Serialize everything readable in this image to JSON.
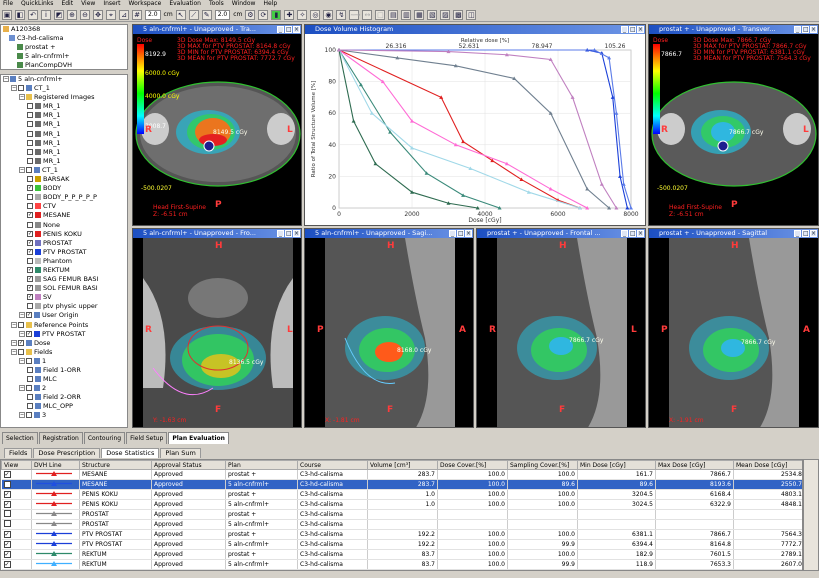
{
  "menu": [
    "File",
    "QuickLinks",
    "Edit",
    "View",
    "Insert",
    "Workspace",
    "Evaluation",
    "Tools",
    "Window",
    "Help"
  ],
  "toolbar": {
    "thickness1": "2.0",
    "unit1": "cm",
    "thickness2": "2.0",
    "unit2": "cm"
  },
  "patient_tree": [
    "A120368",
    "C3-hd-calisma",
    "prostat +",
    "5 aln-cnfrml+",
    "PlanCompDVH"
  ],
  "left_tree": [
    {
      "t": "5 aln-cnfrml+",
      "d": 0
    },
    {
      "t": "CT_1",
      "d": 1
    },
    {
      "t": "Registered Images",
      "d": 2
    },
    {
      "t": "MR_1",
      "d": 3
    },
    {
      "t": "MR_1",
      "d": 3
    },
    {
      "t": "MR_1",
      "d": 3
    },
    {
      "t": "MR_1",
      "d": 3
    },
    {
      "t": "MR_1",
      "d": 3
    },
    {
      "t": "MR_1",
      "d": 3
    },
    {
      "t": "MR_1",
      "d": 3
    },
    {
      "t": "CT_1",
      "d": 2
    },
    {
      "t": "BARSAK",
      "d": 3
    },
    {
      "t": "BODY",
      "d": 3
    },
    {
      "t": "BODY_P_P_P_P_P",
      "d": 3
    },
    {
      "t": "CTV",
      "d": 3
    },
    {
      "t": "MESANE",
      "d": 3
    },
    {
      "t": "None",
      "d": 3
    },
    {
      "t": "PENIS KOKU",
      "d": 3
    },
    {
      "t": "PROSTAT",
      "d": 3
    },
    {
      "t": "PTV PROSTAT",
      "d": 3
    },
    {
      "t": "Phantom",
      "d": 3
    },
    {
      "t": "REKTUM",
      "d": 3
    },
    {
      "t": "SAG FEMUR BASI",
      "d": 3
    },
    {
      "t": "SOL FEMUR BASI",
      "d": 3
    },
    {
      "t": "SV",
      "d": 3
    },
    {
      "t": "ptv physic upper",
      "d": 3
    },
    {
      "t": "User Origin",
      "d": 2
    },
    {
      "t": "Reference Points",
      "d": 1
    },
    {
      "t": "PTV PROSTAT",
      "d": 2
    },
    {
      "t": "Dose",
      "d": 1
    },
    {
      "t": "Fields",
      "d": 1
    },
    {
      "t": "1",
      "d": 2
    },
    {
      "t": "Field 1-ORR",
      "d": 3
    },
    {
      "t": "MLC",
      "d": 3
    },
    {
      "t": "2",
      "d": 2
    },
    {
      "t": "Field 2-ORR",
      "d": 3
    },
    {
      "t": "MLC_OPP",
      "d": 3
    },
    {
      "t": "3",
      "d": 2
    }
  ],
  "panels": {
    "p1": "5 aln-cnfrml+ - Unapproved - Tra...",
    "p2": "Dose Volume Histogram",
    "p3": "prostat + - Unapproved - Transver...",
    "p4": "5 aln-cnfrml+ - Unapproved - Fro...",
    "p5": "5 aln-cnfrml+ - Unapproved - Sagi...",
    "p6": "prostat + - Unapproved - Frontal ...",
    "p7": "prostat + - Unapproved - Sagittal"
  },
  "img1": {
    "dose": "Dose",
    "v1": "8192.9",
    "v2": "6000.0 cGy",
    "v3": "4000.0 cGy",
    "v4": "3008.7",
    "l1": "3D Dose Max: 8149.5 cGy",
    "l2": "3D MAX for PTV PROSTAT: 8164.8 cGy",
    "l3": "3D MIN for PTV PROSTAT: 6394.4 cGy",
    "l4": "3D MEAN for PTV PROSTAT: 7772.7 cGy",
    "center": "8149.5 cGy",
    "bottom": "-500.0207",
    "pos": "Head First-Supine",
    "z": "Z: -6.51 cm",
    "R": "R",
    "L": "L",
    "P": "P"
  },
  "img3": {
    "dose": "Dose",
    "v1": "7866.7",
    "l1": "3D Dose Max: 7866.7 cGy",
    "l2": "3D MAX for PTV PROSTAT: 7866.7 cGy",
    "l3": "3D MIN for PTV PROSTAT: 6381.1 cGy",
    "l4": "3D MEAN for PTV PROSTAT: 7564.3 cGy",
    "center": "7866.7 cGy",
    "bottom": "-500.0207",
    "pos": "Head First-Supine",
    "z": "Z: -6.51 cm",
    "R": "R",
    "L": "L",
    "P": "P"
  },
  "img4": {
    "R": "R",
    "L": "L",
    "F": "F",
    "H": "H",
    "center": "8136.5 cGy",
    "y": "Y: -1.63 cm"
  },
  "img5": {
    "P": "P",
    "A": "A",
    "H": "H",
    "F": "F",
    "center": "8168.0 cGy",
    "x": "X: -1.81 cm"
  },
  "img6": {
    "R": "R",
    "L": "L",
    "H": "H",
    "F": "F",
    "center": "7866.7 cGy"
  },
  "img7": {
    "P": "P",
    "A": "A",
    "H": "H",
    "F": "F",
    "center": "7866.7 cGy",
    "x": "X: -1.91 cm"
  },
  "chart_data": {
    "type": "line",
    "title": "",
    "xlabel": "Dose [cGy]",
    "ylabel": "Ratio of Total Structure Volume [%]",
    "x2label": "Relative dose [%]",
    "x2ticks": [
      "26.316",
      "52.631",
      "78.947",
      "105.26"
    ],
    "xlim": [
      0,
      8000
    ],
    "ylim": [
      0,
      100
    ],
    "xticks": [
      0,
      2000,
      4000,
      6000,
      8000
    ],
    "yticks": [
      0,
      20,
      40,
      60,
      80,
      100
    ],
    "series": [
      {
        "color": "#1a3fd8",
        "x": [
          0,
          6800,
          7200,
          7500,
          7700,
          7900
        ],
        "y": [
          100,
          100,
          98,
          70,
          20,
          0
        ]
      },
      {
        "color": "#5b7be8",
        "x": [
          0,
          7000,
          7400,
          7600,
          7800,
          8000
        ],
        "y": [
          100,
          100,
          95,
          60,
          15,
          0
        ]
      },
      {
        "color": "#e02020",
        "x": [
          0,
          2800,
          3400,
          4200,
          5000,
          6000,
          6600
        ],
        "y": [
          100,
          70,
          42,
          30,
          18,
          5,
          0
        ]
      },
      {
        "color": "#ff6ad5",
        "x": [
          0,
          1200,
          2000,
          3200,
          4600,
          5800,
          6800
        ],
        "y": [
          100,
          80,
          55,
          40,
          28,
          12,
          0
        ]
      },
      {
        "color": "#3a8a7a",
        "x": [
          0,
          600,
          1400,
          2400,
          3400,
          4400
        ],
        "y": [
          100,
          78,
          48,
          22,
          8,
          0
        ]
      },
      {
        "color": "#708090",
        "x": [
          0,
          1600,
          3200,
          4800,
          5800,
          6800,
          7400
        ],
        "y": [
          100,
          95,
          90,
          82,
          60,
          12,
          0
        ]
      },
      {
        "color": "#a0d8e8",
        "x": [
          0,
          900,
          2000,
          3600,
          5200,
          6600
        ],
        "y": [
          100,
          60,
          38,
          25,
          10,
          0
        ]
      },
      {
        "color": "#2e6b50",
        "x": [
          0,
          400,
          1000,
          2000,
          3000,
          3800
        ],
        "y": [
          100,
          55,
          28,
          10,
          3,
          0
        ]
      },
      {
        "color": "#c080c0",
        "x": [
          0,
          3000,
          4600,
          5800,
          6400,
          7200,
          7600
        ],
        "y": [
          100,
          99,
          97,
          94,
          70,
          15,
          0
        ]
      }
    ]
  },
  "tabs": [
    "Selection",
    "Registration",
    "Contouring",
    "Field Setup",
    "Plan Evaluation"
  ],
  "subtabs": [
    "Fields",
    "Dose Prescription",
    "Dose Statistics",
    "Plan Sum"
  ],
  "table": {
    "headers": [
      "View",
      "DVH Line",
      "Structure",
      "Approval Status",
      "Plan",
      "Course",
      "Volume [cm³]",
      "Dose Cover.[%]",
      "Sampling Cover.[%]",
      "Min Dose [cGy]",
      "Max Dose [cGy]",
      "Mean Dose [cGy]"
    ],
    "rows": [
      {
        "v": true,
        "c": "#e02020",
        "s": "MESANE",
        "a": "Approved",
        "p": "prostat +",
        "co": "C3-hd-calisma",
        "vol": "283.7",
        "dc": "100.0",
        "sc": "100.0",
        "mn": "161.7",
        "mx": "7866.7",
        "me": "2534.8",
        "sel": false
      },
      {
        "v": true,
        "c": "#2050e0",
        "s": "MESANE",
        "a": "Approved",
        "p": "5 aln-cnfrml+",
        "co": "C3-hd-calisma",
        "vol": "283.7",
        "dc": "100.0",
        "sc": "89.6",
        "mn": "89.6",
        "mx": "8193.6",
        "me": "2550.7",
        "sel": true
      },
      {
        "v": true,
        "c": "#e02020",
        "s": "PENIS KOKU",
        "a": "Approved",
        "p": "prostat +",
        "co": "C3-hd-calisma",
        "vol": "1.0",
        "dc": "100.0",
        "sc": "100.0",
        "mn": "3204.5",
        "mx": "6168.4",
        "me": "4803.1",
        "sel": false
      },
      {
        "v": true,
        "c": "#e02020",
        "s": "PENIS KOKU",
        "a": "Approved",
        "p": "5 aln-cnfrml+",
        "co": "C3-hd-calisma",
        "vol": "1.0",
        "dc": "100.0",
        "sc": "100.0",
        "mn": "3024.5",
        "mx": "6322.9",
        "me": "4848.1",
        "sel": false
      },
      {
        "v": false,
        "c": "#888888",
        "s": "PROSTAT",
        "a": "Approved",
        "p": "prostat +",
        "co": "C3-hd-calisma",
        "vol": "",
        "dc": "",
        "sc": "",
        "mn": "",
        "mx": "",
        "me": "",
        "sel": false
      },
      {
        "v": false,
        "c": "#888888",
        "s": "PROSTAT",
        "a": "Approved",
        "p": "5 aln-cnfrml+",
        "co": "C3-hd-calisma",
        "vol": "",
        "dc": "",
        "sc": "",
        "mn": "",
        "mx": "",
        "me": "",
        "sel": false
      },
      {
        "v": true,
        "c": "#1a3fd8",
        "s": "PTV PROSTAT",
        "a": "Approved",
        "p": "prostat +",
        "co": "C3-hd-calisma",
        "vol": "192.2",
        "dc": "100.0",
        "sc": "100.0",
        "mn": "6381.1",
        "mx": "7866.7",
        "me": "7564.3",
        "sel": false
      },
      {
        "v": true,
        "c": "#1a3fd8",
        "s": "PTV PROSTAT",
        "a": "Approved",
        "p": "5 aln-cnfrml+",
        "co": "C3-hd-calisma",
        "vol": "192.2",
        "dc": "100.0",
        "sc": "99.9",
        "mn": "6394.4",
        "mx": "8164.8",
        "me": "7772.7",
        "sel": false
      },
      {
        "v": true,
        "c": "#2e8a6a",
        "s": "REKTUM",
        "a": "Approved",
        "p": "prostat +",
        "co": "C3-hd-calisma",
        "vol": "83.7",
        "dc": "100.0",
        "sc": "100.0",
        "mn": "182.9",
        "mx": "7601.5",
        "me": "2789.1",
        "sel": false
      },
      {
        "v": true,
        "c": "#40b0ff",
        "s": "REKTUM",
        "a": "Approved",
        "p": "5 aln-cnfrml+",
        "co": "C3-hd-calisma",
        "vol": "83.7",
        "dc": "100.0",
        "sc": "99.9",
        "mn": "118.9",
        "mx": "7653.3",
        "me": "2607.0",
        "sel": false
      }
    ]
  }
}
